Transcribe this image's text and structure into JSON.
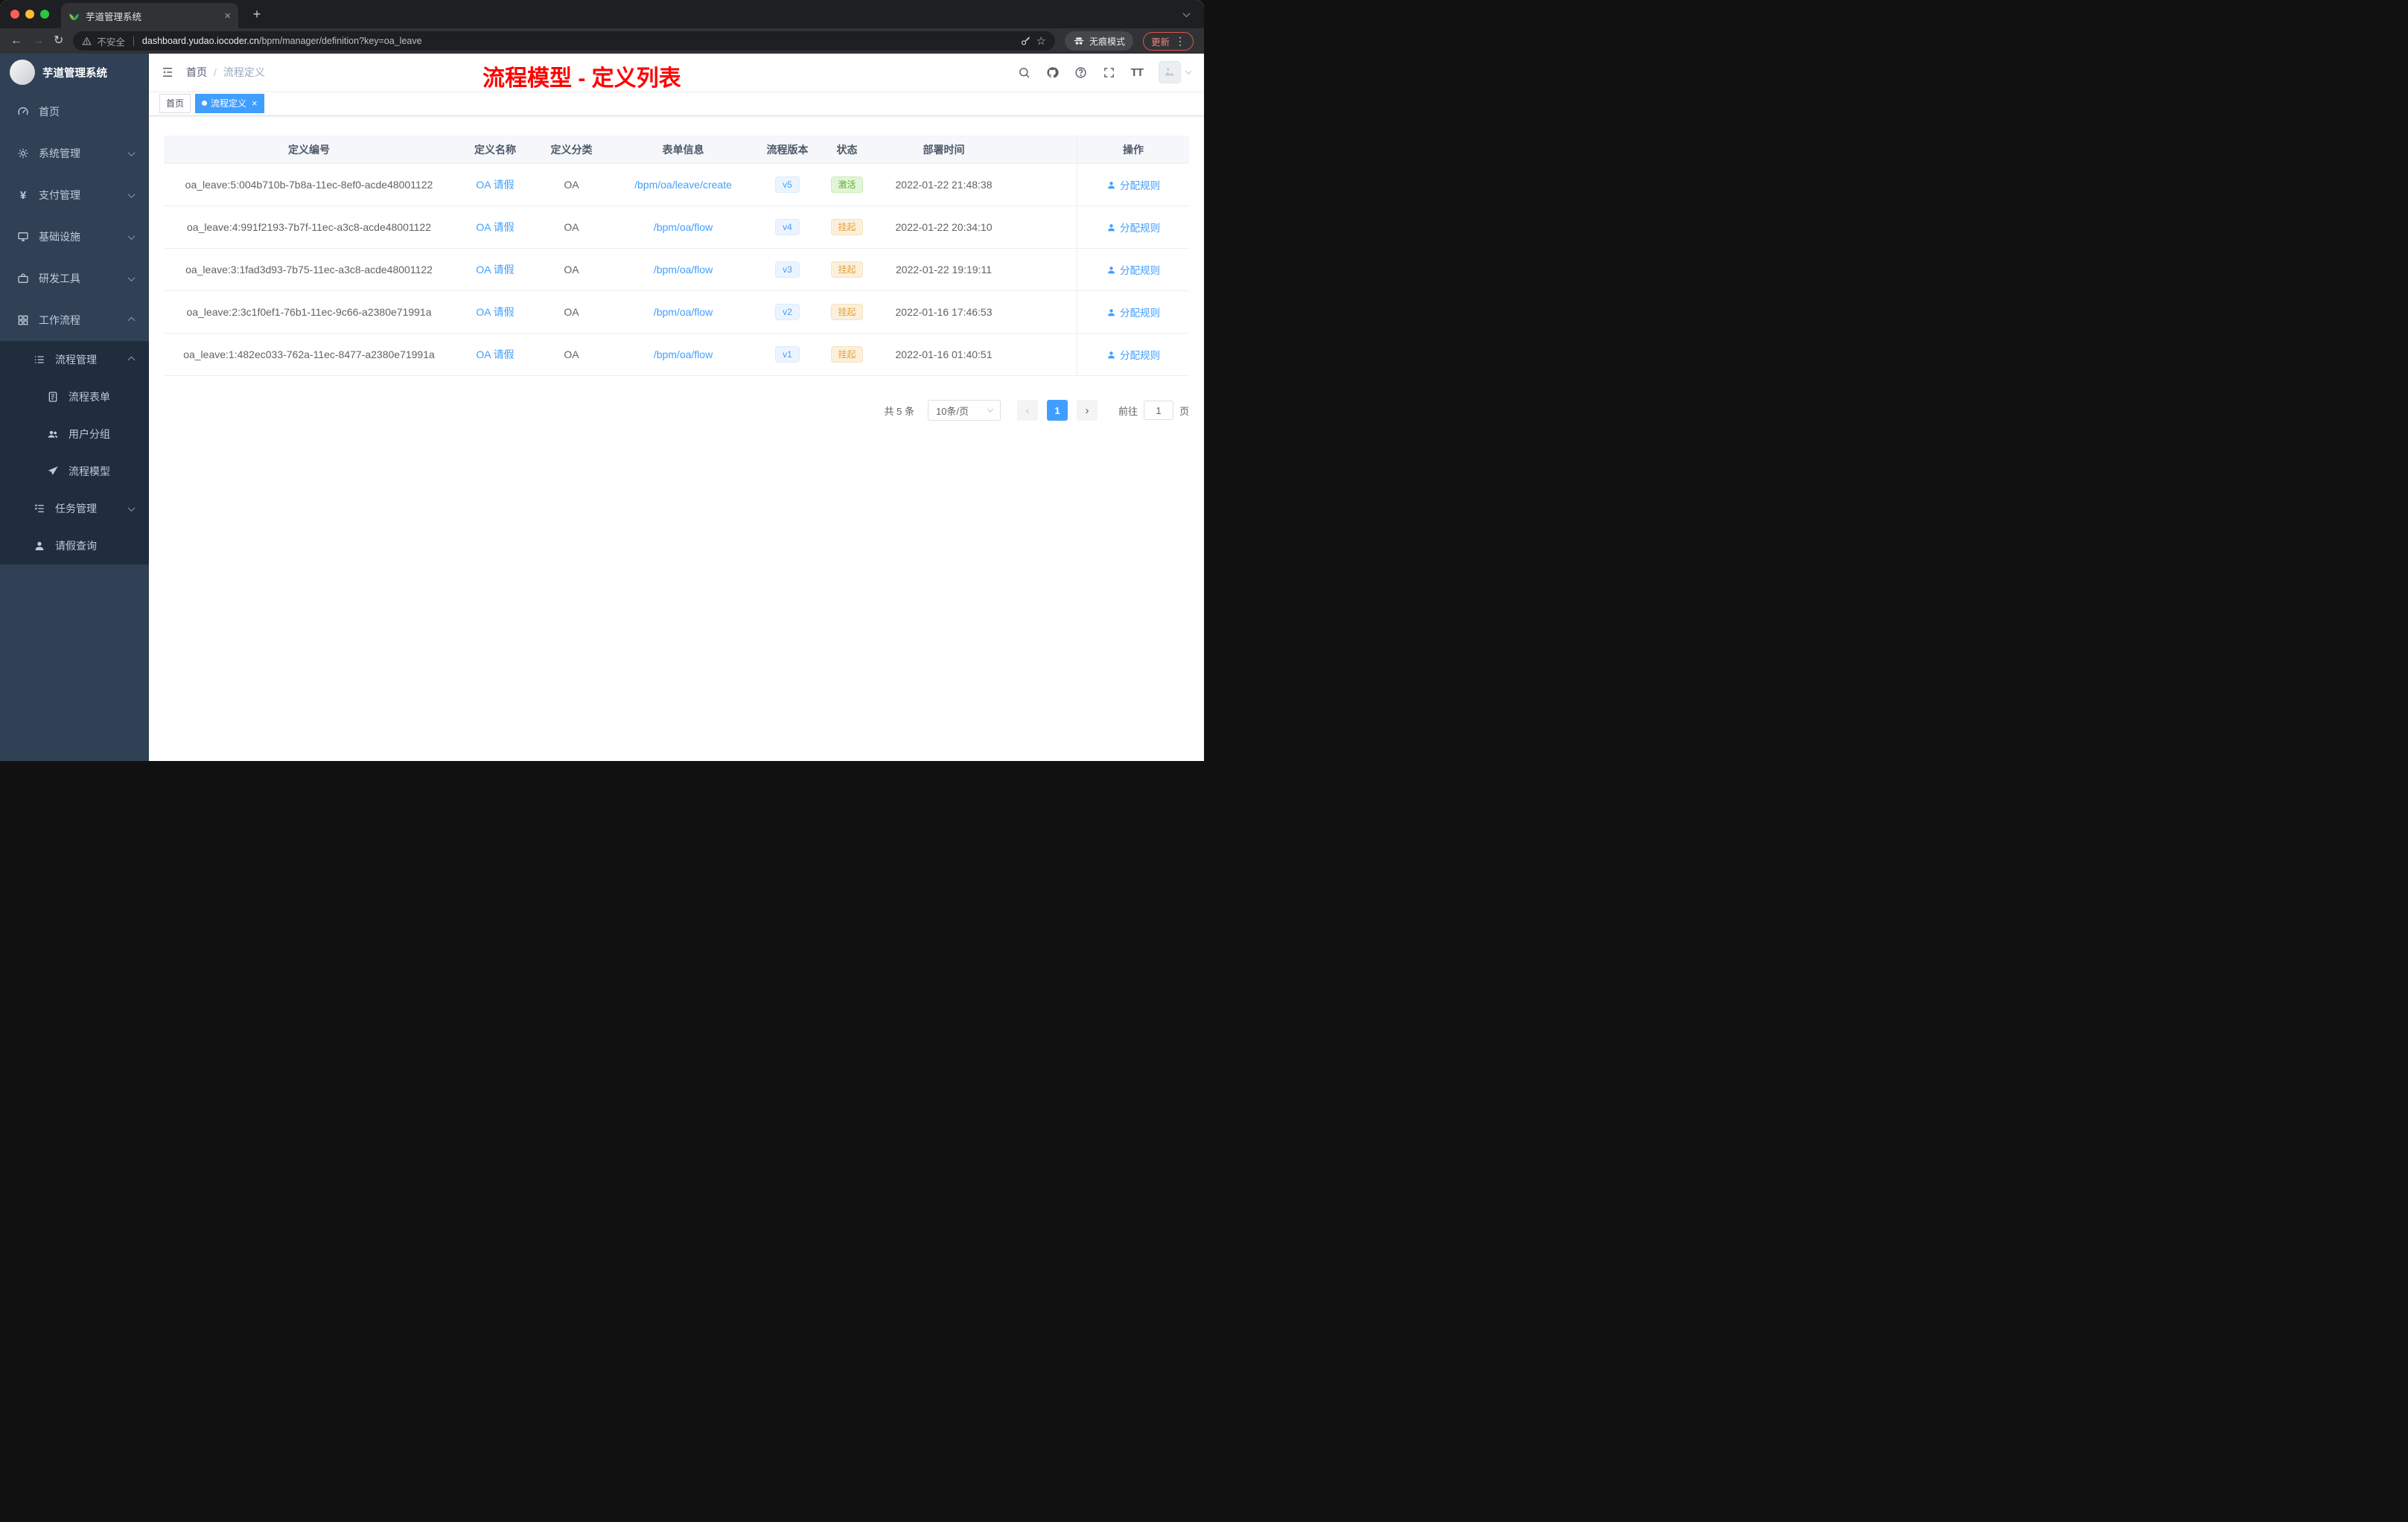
{
  "browser": {
    "tab_title": "芋道管理系统",
    "not_secure": "不安全",
    "url_domain": "dashboard.yudao.iocoder.cn",
    "url_path": "/bpm/manager/definition?key=oa_leave",
    "incognito": "无痕模式",
    "update": "更新"
  },
  "icons": {
    "close": "×",
    "plus": "+",
    "back": "←",
    "forward": "→",
    "reload": "↻",
    "star": "☆",
    "kebab": "⋮",
    "prev": "‹",
    "next": "›",
    "yen": "¥",
    "font_size": "TT"
  },
  "sidebar": {
    "logo_title": "芋道管理系统",
    "items": [
      {
        "label": "首页"
      },
      {
        "label": "系统管理"
      },
      {
        "label": "支付管理"
      },
      {
        "label": "基础设施"
      },
      {
        "label": "研发工具"
      },
      {
        "label": "工作流程"
      },
      {
        "label": "流程管理"
      },
      {
        "label": "流程表单"
      },
      {
        "label": "用户分组"
      },
      {
        "label": "流程模型"
      },
      {
        "label": "任务管理"
      },
      {
        "label": "请假查询"
      }
    ]
  },
  "navbar": {
    "breadcrumb_home": "首页",
    "breadcrumb_separator": "/",
    "breadcrumb_current": "流程定义",
    "annotation": "流程模型 - 定义列表"
  },
  "tags": {
    "home": "首页",
    "current": "流程定义"
  },
  "table": {
    "columns": [
      "定义编号",
      "定义名称",
      "定义分类",
      "表单信息",
      "流程版本",
      "状态",
      "部署时间",
      "操作"
    ],
    "rows": [
      {
        "id": "oa_leave:5:004b710b-7b8a-11ec-8ef0-acde48001122",
        "name": "OA 请假",
        "category": "OA",
        "form": "/bpm/oa/leave/create",
        "version": "v5",
        "status": "激活",
        "time": "2022-01-22 21:48:38",
        "action": "分配规则"
      },
      {
        "id": "oa_leave:4:991f2193-7b7f-11ec-a3c8-acde48001122",
        "name": "OA 请假",
        "category": "OA",
        "form": "/bpm/oa/flow",
        "version": "v4",
        "status": "挂起",
        "time": "2022-01-22 20:34:10",
        "action": "分配规则"
      },
      {
        "id": "oa_leave:3:1fad3d93-7b75-11ec-a3c8-acde48001122",
        "name": "OA 请假",
        "category": "OA",
        "form": "/bpm/oa/flow",
        "version": "v3",
        "status": "挂起",
        "time": "2022-01-22 19:19:11",
        "action": "分配规则"
      },
      {
        "id": "oa_leave:2:3c1f0ef1-76b1-11ec-9c66-a2380e71991a",
        "name": "OA 请假",
        "category": "OA",
        "form": "/bpm/oa/flow",
        "version": "v2",
        "status": "挂起",
        "time": "2022-01-16 17:46:53",
        "action": "分配规则"
      },
      {
        "id": "oa_leave:1:482ec033-762a-11ec-8477-a2380e71991a",
        "name": "OA 请假",
        "category": "OA",
        "form": "/bpm/oa/flow",
        "version": "v1",
        "status": "挂起",
        "time": "2022-01-16 01:40:51",
        "action": "分配规则"
      }
    ]
  },
  "pagination": {
    "total": "共 5 条",
    "page_size": "10条/页",
    "current": "1",
    "goto_prefix": "前往",
    "goto_value": "1",
    "goto_suffix": "页"
  },
  "colors": {
    "accent": "#409eff",
    "success": "#67c23a",
    "warning": "#e6a23c",
    "annotation": "#fe0100",
    "sidebar_bg": "#304156",
    "submenu_bg": "#1f2d3d"
  }
}
